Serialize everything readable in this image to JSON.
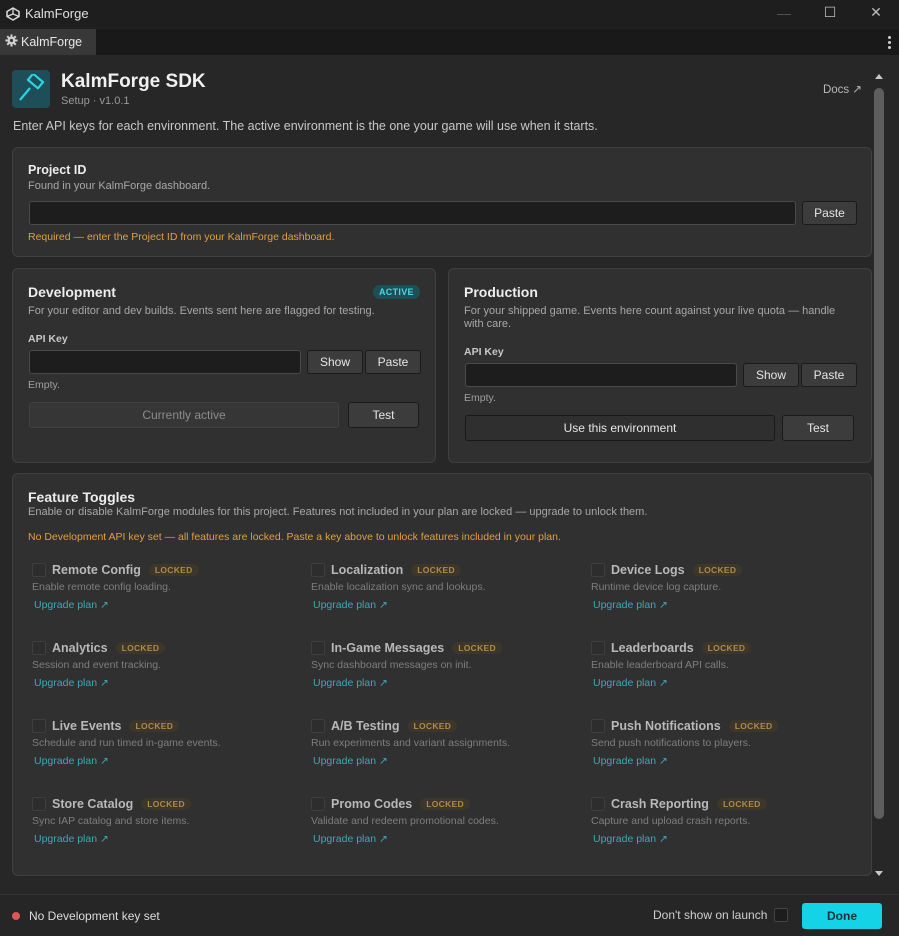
{
  "window": {
    "title": "KalmForge",
    "controls": {
      "minimize": "—",
      "maximize": "☐",
      "close": "✕"
    }
  },
  "tab": {
    "label": "KalmForge"
  },
  "header": {
    "name": "KalmForge SDK",
    "subtitle": "Setup · v1.0.1",
    "docs_label": "Docs ↗"
  },
  "intro": "Enter API keys for each environment. The active environment is the one your game will use when it starts.",
  "project": {
    "title": "Project ID",
    "description": "Found in your KalmForge dashboard.",
    "value": "",
    "paste_label": "Paste",
    "warning": "Required — enter the Project ID from your KalmForge dashboard."
  },
  "development": {
    "title": "Development",
    "badge": "ACTIVE",
    "description": "For your editor and dev builds. Events sent here are flagged for testing.",
    "api_key_label": "API Key",
    "api_key_value": "",
    "show_label": "Show",
    "paste_label": "Paste",
    "status": "Empty.",
    "primary_button": "Currently active",
    "test_label": "Test"
  },
  "production": {
    "title": "Production",
    "description": "For your shipped game. Events here count against your live quota — handle with care.",
    "api_key_label": "API Key",
    "api_key_value": "",
    "show_label": "Show",
    "paste_label": "Paste",
    "status": "Empty.",
    "primary_button": "Use this environment",
    "test_label": "Test"
  },
  "features": {
    "title": "Feature Toggles",
    "description": "Enable or disable KalmForge modules for this project. Features not included in your plan are locked — upgrade to unlock them.",
    "warning": "No Development API key set — all features are locked. Paste a key above to unlock features included in your plan.",
    "locked_label": "LOCKED",
    "upgrade_label": "Upgrade plan ↗",
    "items": [
      {
        "name": "Remote Config",
        "desc": "Enable remote config loading."
      },
      {
        "name": "Localization",
        "desc": "Enable localization sync and lookups."
      },
      {
        "name": "Device Logs",
        "desc": "Runtime device log capture."
      },
      {
        "name": "Analytics",
        "desc": "Session and event tracking."
      },
      {
        "name": "In-Game Messages",
        "desc": "Sync dashboard messages on init."
      },
      {
        "name": "Leaderboards",
        "desc": "Enable leaderboard API calls."
      },
      {
        "name": "Live Events",
        "desc": "Schedule and run timed in-game events."
      },
      {
        "name": "A/B Testing",
        "desc": "Run experiments and variant assignments."
      },
      {
        "name": "Push Notifications",
        "desc": "Send push notifications to players."
      },
      {
        "name": "Store Catalog",
        "desc": "Sync IAP catalog and store items."
      },
      {
        "name": "Promo Codes",
        "desc": "Validate and redeem promotional codes."
      },
      {
        "name": "Crash Reporting",
        "desc": "Capture and upload crash reports."
      }
    ]
  },
  "footer": {
    "status": "No Development key set",
    "dont_show_label": "Don't show on launch",
    "done_label": "Done"
  },
  "colors": {
    "accent": "#15d3e6",
    "warning": "#e0a040",
    "error_dot": "#e05555",
    "link": "#3fa8b8"
  }
}
